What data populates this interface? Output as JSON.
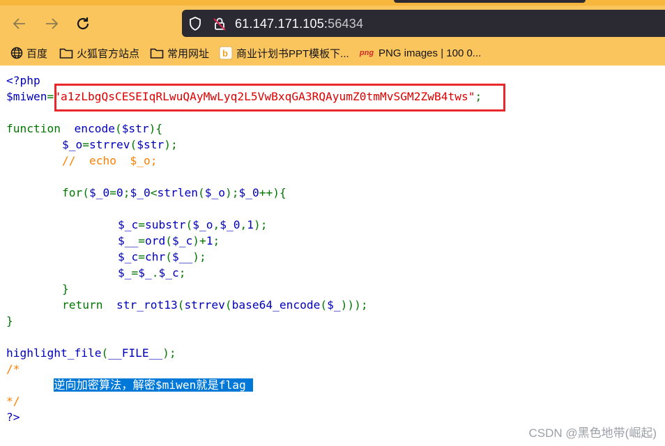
{
  "browser": {
    "url_host": "61.147.171.105:",
    "url_port": "56434",
    "bookmarks": [
      {
        "label": "百度",
        "icon": "globe-icon"
      },
      {
        "label": "火狐官方站点",
        "icon": "folder-icon"
      },
      {
        "label": "常用网址",
        "icon": "folder-icon"
      },
      {
        "label": "商业计划书PPT模板下...",
        "icon": "bookmark-favicon-icon"
      },
      {
        "label": "PNG images | 100 0...",
        "icon": "png-favicon-icon",
        "badge": "png"
      }
    ]
  },
  "code": {
    "line1": "<?php",
    "line2_var": "$miwen",
    "line2_eq": "=",
    "line2_str": "\"a1zLbgQsCESEIqRLwuQAyMwLyq2L5VwBxqGA3RQAyumZ0tmMvSGM2ZwB4tws\"",
    "line2_semi": ";",
    "l4_kw": "function",
    "l4_name": "  encode",
    "l4_p1": "(",
    "l4_arg": "$str",
    "l4_p2": "){",
    "l5_var": "$_o",
    "l5_eq": "=",
    "l5_fn": "strrev",
    "l5_p1": "(",
    "l5_arg": "$str",
    "l5_p2": ");",
    "l6": "//  echo  $_o;",
    "l8_kw": "for(",
    "l8_v1": "$_0",
    "l8_eq": "=",
    "l8_n0": "0",
    "l8_s1": ";",
    "l8_v2": "$_0",
    "l8_lt": "<",
    "l8_fn": "strlen",
    "l8_p1": "(",
    "l8_v3": "$_o",
    "l8_p2": ");",
    "l8_v4": "$_0",
    "l8_inc": "++){",
    "l10_var": "$_c",
    "l10_eq": "=",
    "l10_fn": "substr",
    "l10_p1": "(",
    "l10_a1": "$_o",
    "l10_c1": ",",
    "l10_a2": "$_0",
    "l10_c2": ",",
    "l10_a3": "1",
    "l10_p2": ");",
    "l11_var": "$__",
    "l11_eq": "=",
    "l11_fn": "ord",
    "l11_p1": "(",
    "l11_a1": "$_c",
    "l11_p2": ")+",
    "l11_n": "1",
    "l11_s": ";",
    "l12_var": "$_c",
    "l12_eq": "=",
    "l12_fn": "chr",
    "l12_p1": "(",
    "l12_a1": "$__",
    "l12_p2": ");",
    "l13_var": "$_",
    "l13_eq": "=",
    "l13_a1": "$_",
    "l13_dot": ".",
    "l13_a2": "$_c",
    "l13_s": ";",
    "l14": "}",
    "l15_kw": "return",
    "l15_fn": "  str_rot13",
    "l15_p1": "(",
    "l15_fn2": "strrev",
    "l15_p2": "(",
    "l15_fn3": "base64_encode",
    "l15_p3": "(",
    "l15_a": "$_",
    "l15_p4": ")));",
    "l16": "}",
    "l18_fn": "highlight_file",
    "l18_p1": "(",
    "l18_a": "__FILE__",
    "l18_p2": ");",
    "l19": "/*",
    "l20_indent": "       ",
    "l20_hl": "逆向加密算法，解密$miwen就是flag ",
    "l21": "*/",
    "l22": "?>"
  },
  "watermark": "CSDN @黑色地带(崛起)",
  "colors": {
    "toolbar": "#f9c55c",
    "urlbar": "#2b2a33",
    "php_default": "#0000bb",
    "php_keyword": "#007700",
    "php_string": "#dd0000",
    "php_comment": "#ff8000",
    "selection": "#0078d7",
    "annotation_box": "#e8282a"
  }
}
